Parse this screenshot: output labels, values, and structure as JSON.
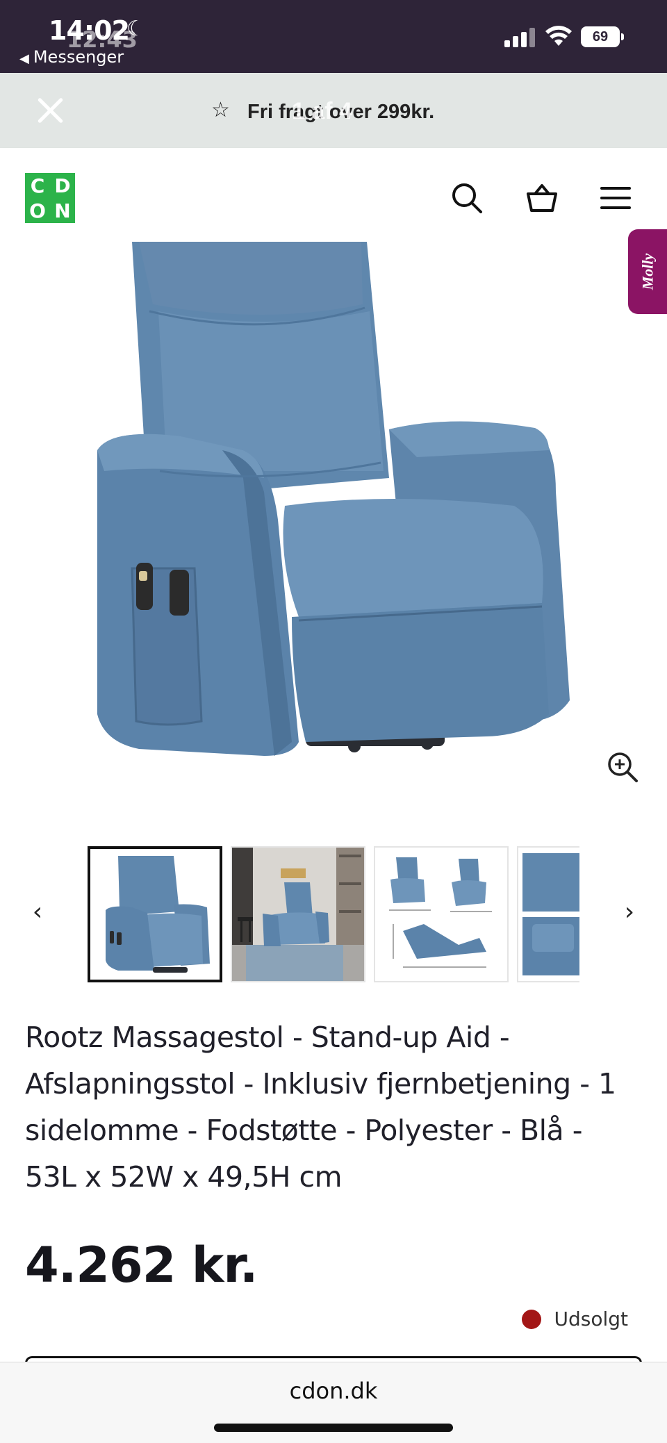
{
  "status_bar": {
    "time": "14:02",
    "ghost_time": "12:43",
    "back_app": "Messenger",
    "battery": "69"
  },
  "promo": {
    "text": "Fri fragt over 299kr.",
    "counter": "1 af 4"
  },
  "header": {
    "logo_letters": [
      "C",
      "D",
      "O",
      "N"
    ],
    "brand_color": "#2cb34a"
  },
  "molly_tab": {
    "label": "Molly",
    "color": "#8b1464"
  },
  "gallery": {
    "thumbnails": [
      "chair-front",
      "chair-room",
      "chair-dimensions",
      "chair-details"
    ],
    "active_index": 0
  },
  "product": {
    "title": "Rootz Massagestol - Stand-up Aid - Afslapningsstol - Inklusiv fjernbetjening - 1 sidelomme - Fodstøtte - Polyester - Blå - 53L x 52W x 49,5H cm",
    "price": "4.262 kr.",
    "availability": "Udsolgt",
    "availability_color": "#a31616"
  },
  "browser": {
    "url": "cdon.dk"
  }
}
